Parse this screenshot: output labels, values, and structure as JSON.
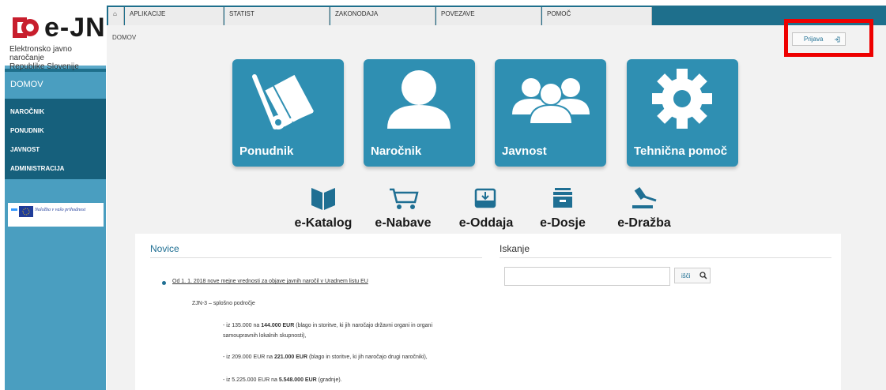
{
  "logo": {
    "name": "e-JN",
    "subtitle_line1": "Elektronsko javno naročanje",
    "subtitle_line2": "Republike Slovenije"
  },
  "sidebar": {
    "home": "DOMOV",
    "items": [
      {
        "label": "NAROČNIK"
      },
      {
        "label": "PONUDNIK"
      },
      {
        "label": "JAVNOST"
      },
      {
        "label": "ADMINISTRACIJA"
      }
    ],
    "banner_text": "Naložba v vašo prihodnost"
  },
  "topnav": {
    "items": [
      {
        "label": "APLIKACIJE"
      },
      {
        "label": "STATIST"
      },
      {
        "label": "ZAKONODAJA"
      },
      {
        "label": "POVEZAVE"
      },
      {
        "label": "POMOČ"
      }
    ]
  },
  "breadcrumb": "DOMOV",
  "login": {
    "label": "Prijava"
  },
  "tiles": [
    {
      "label": "Ponudnik",
      "icon": "hand-truck-icon"
    },
    {
      "label": "Naročnik",
      "icon": "user-icon"
    },
    {
      "label": "Javnost",
      "icon": "group-icon"
    },
    {
      "label": "Tehnična pomoč",
      "icon": "gear-icon"
    }
  ],
  "modules": [
    {
      "label": "e-Katalog",
      "icon": "book-icon"
    },
    {
      "label": "e-Nabave",
      "icon": "cart-icon"
    },
    {
      "label": "e-Oddaja",
      "icon": "inbox-icon"
    },
    {
      "label": "e-Dosje",
      "icon": "archive-icon"
    },
    {
      "label": "e-Dražba",
      "icon": "gavel-icon"
    }
  ],
  "novice": {
    "title": "Novice",
    "link": "Od 1. 1. 2018 nove mejne vrednosti za objave javnih naročil v Uradnem listu EU",
    "heading": "ZJN-3 – splošno področje",
    "lines": [
      {
        "pre": "- iz 135.000 na ",
        "bold": "144.000 EUR",
        "post": " (blago in storitve, ki jih naročajo državni organi in organi"
      },
      {
        "pre": "samoupravnih lokalnih skupnosti),",
        "bold": "",
        "post": ""
      },
      {
        "pre": "- iz 209.000 EUR na ",
        "bold": "221.000 EUR",
        "post": " (blago in storitve, ki jih naročajo drugi naročniki),"
      },
      {
        "pre": "- iz 5.225.000 EUR na ",
        "bold": "5.548.000 EUR",
        "post": " (gradnje)."
      }
    ]
  },
  "iskanje": {
    "title": "Iskanje",
    "placeholder": "",
    "button": "išči"
  },
  "colors": {
    "primary": "#1e6f8c",
    "tile": "#2f8fb2",
    "highlight": "#e00000"
  }
}
